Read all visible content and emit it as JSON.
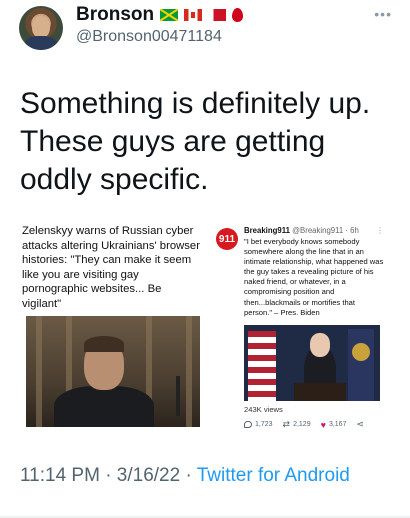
{
  "author": {
    "display_name": "Bronson",
    "handle": "@Bronson00471184",
    "flags": [
      "jamaica-flag",
      "canada-flag",
      "bahrain-flag",
      "drop-of-blood"
    ]
  },
  "tweet": {
    "text": "Something is definitely up.  These guys are getting oddly specific."
  },
  "left_card": {
    "headline": "Zelenskyy warns of Russian cyber attacks altering Ukrainians' browser histories: \"They can make it seem like you are visiting gay pornographic websites... Be vigilant\""
  },
  "right_card": {
    "logo_text": "911",
    "name": "Breaking911",
    "handle_time": "@Breaking911 · 6h",
    "more": "⋮",
    "text": "\"I bet everybody knows somebody somewhere along the line that in an intimate relationship, what happened was the guy takes a revealing picture of his naked friend, or whatever, in a compromising position and then...blackmails or mortifies that person.\" – Pres. Biden",
    "views": "243K views",
    "replies": "1,723",
    "retweets": "2,129",
    "likes": "3,167"
  },
  "footer": {
    "time_date": "11:14 PM · 3/16/22 · ",
    "source": "Twitter for Android"
  },
  "colors": {
    "text_primary": "#0f1419",
    "text_secondary": "#536471",
    "link": "#1d9bf0",
    "like": "#d01867"
  }
}
